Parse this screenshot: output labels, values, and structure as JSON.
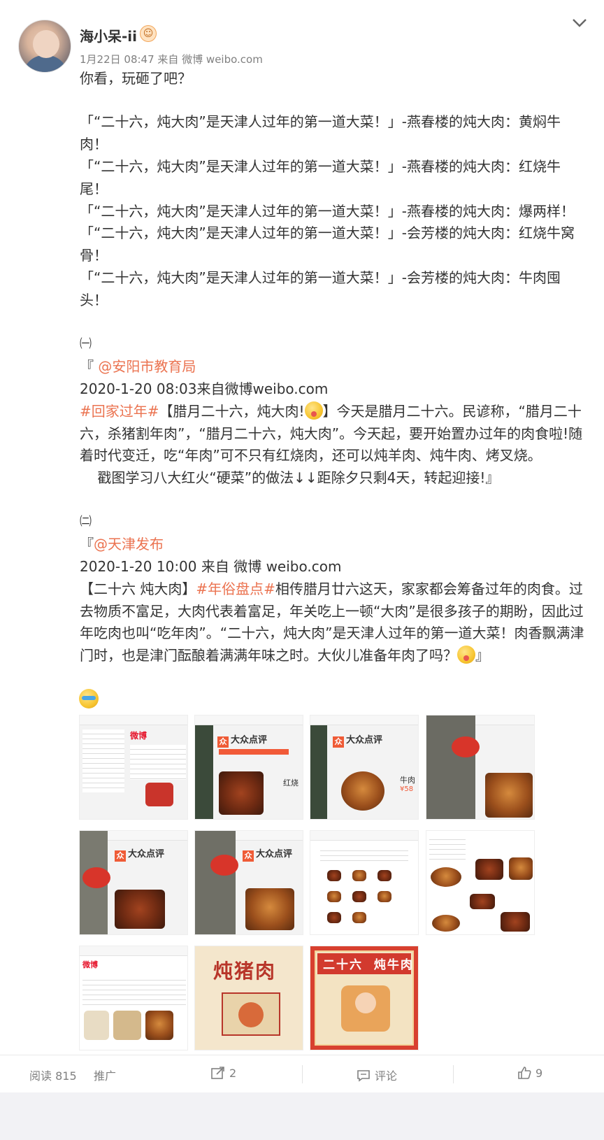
{
  "post": {
    "username": "海小呆-ii",
    "meta": "1月22日 08:47 来自 微博 weibo.com",
    "body_lines": [
      "你看，玩砸了吧？",
      "「“二十六，炖大肉”是天津人过年的第一道大菜！」-燕春楼的炖大肉：黄焖牛",
      "肉！",
      "「“二十六，炖大肉”是天津人过年的第一道大菜！」-燕春楼的炖大肉：红烧牛",
      "尾！",
      "「“二十六，炖大肉”是天津人过年的第一道大菜！」-燕春楼的炖大肉：爆两样！",
      "「“二十六，炖大肉”是天津人过年的第一道大菜！」-会芳楼的炖大肉：红烧牛窝",
      "骨！",
      "「“二十六，炖大肉”是天津人过年的第一道大菜！」-会芳楼的炖大肉：牛肉囤",
      "头！"
    ],
    "quote1": {
      "index": "㈠",
      "open": "『",
      "mention": "@安阳市教育局",
      "date": "2020-1-20 08:03来自微博weibo.com",
      "hashtag": "#回家过年#",
      "line1_rest": "【腊月二十六，炖大肉!",
      "line1_tail": "】今天是腊月二十六。民谚称，“腊月二十",
      "line2": "六，杀猪割年肉”，“腊月二十六，炖大肉”。今天起，要开始置办过年的肉食啦!随",
      "line3": "着时代变迁，吃“年肉”可不只有红烧肉，还可以炖羊肉、炖牛肉、烤叉烧。",
      "line4": "    戳图学习八大红火“硬菜”的做法↓↓距除夕只剩4天，转起迎接!』"
    },
    "quote2": {
      "index": "㈡",
      "open": "『",
      "mention": "@天津发布",
      "date": "2020-1-20 10:00 来自 微博 weibo.com",
      "line1_a": "【二十六 炖大肉】",
      "hashtag": "#年俗盘点#",
      "line1_b": "相传腊月廿六这天，家家都会筹备过年的肉食。过",
      "line2": "去物质不富足，大肉代表着富足，年关吃上一顿“大肉”是很多孩子的期盼，因此过",
      "line3": "年吃肉也叫“吃年肉”。“二十六，炖大肉”是天津人过年的第一道大菜！肉香飘满津",
      "line4": "门时，也是津门酝酿着满满年味之时。大伙儿准备年肉了吗？",
      "line4_end": "』"
    },
    "images": {
      "dianping_logo": "大众点评",
      "weibo_logo": "微博",
      "snippet_hongshao": "红烧",
      "snippet_niurou": "牛肉",
      "snippet_price": "¥58",
      "poster1_title": "炖猪肉",
      "poster2_title": "二十六  炖牛肉"
    }
  },
  "footer": {
    "reads": "阅读 815",
    "promote": "推广",
    "reposts": "2",
    "comments": "评论",
    "likes": "9"
  },
  "colors": {
    "link": "#eb7350",
    "text": "#333333",
    "meta": "#808080"
  }
}
